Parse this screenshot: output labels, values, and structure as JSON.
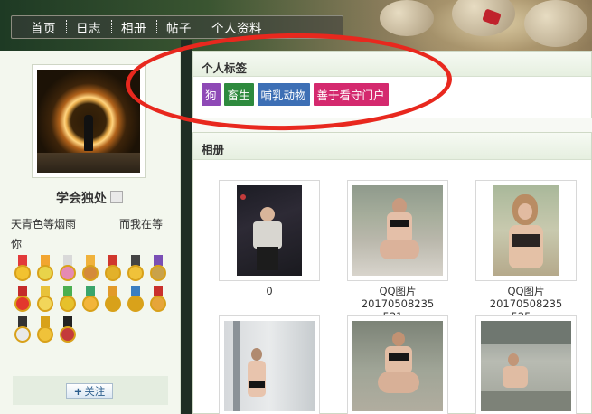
{
  "nav": {
    "items": [
      "首页",
      "日志",
      "相册",
      "帖子",
      "个人资料"
    ]
  },
  "profile": {
    "username": "学会独处",
    "bio_line1": "天青色等烟雨",
    "bio_line2": "而我在等",
    "bio_line3": "你",
    "follow_label": "关注",
    "medal_count": 17
  },
  "tags_panel": {
    "title": "个人标签",
    "tags": [
      {
        "label": "狗",
        "color": "#8e49b6"
      },
      {
        "label": "畜生",
        "color": "#2e8a3e"
      },
      {
        "label": "哺乳动物",
        "color": "#3d6fb5"
      },
      {
        "label": "善于看守门户",
        "color": "#d4296e"
      }
    ]
  },
  "album_panel": {
    "title": "相册",
    "items": [
      {
        "caption_line1": "0",
        "caption_line2": ""
      },
      {
        "caption_line1": "QQ图片20170508235",
        "caption_line2": "531 .."
      },
      {
        "caption_line1": "QQ图片20170508235",
        "caption_line2": "525 .."
      },
      {
        "caption_line1": "",
        "caption_line2": ""
      },
      {
        "caption_line1": "",
        "caption_line2": ""
      },
      {
        "caption_line1": "",
        "caption_line2": ""
      }
    ]
  },
  "colors": {
    "annotation": "#e8281e",
    "panel_border": "#cfd9c6",
    "divider": "#1f2e24"
  }
}
